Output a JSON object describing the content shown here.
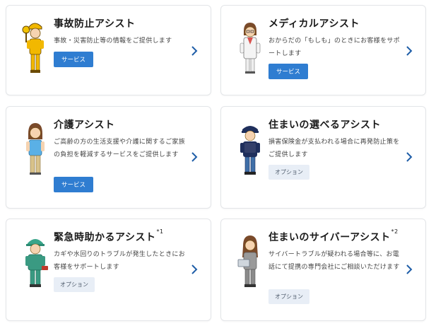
{
  "accent_color": "#2f7dd1",
  "cards": [
    {
      "title": "事故防止アシスト",
      "description": "事故・災害防止等の情報をご提供します",
      "badge": "サービス",
      "badge_type": "service",
      "icon": "child-crossing-guard-icon"
    },
    {
      "title": "メディカルアシスト",
      "description": "おからだの「もしも」のときにお客様をサポートします",
      "badge": "サービス",
      "badge_type": "service",
      "icon": "doctor-icon"
    },
    {
      "title": "介護アシスト",
      "description": "ご高齢の方の生活支援や介護に関するご家族の負担を軽減するサービスをご提供します",
      "badge": "サービス",
      "badge_type": "service",
      "icon": "caregiver-icon"
    },
    {
      "title": "住まいの選べるアシスト",
      "description": "損害保険金が支払われる場合に再発防止策をご提供します",
      "badge": "オプション",
      "badge_type": "option",
      "icon": "security-guard-icon"
    },
    {
      "title": "緊急時助かるアシスト",
      "title_note": "*1",
      "description": "カギや水回りのトラブルが発生したときにお客様をサポートします",
      "badge": "オプション",
      "badge_type": "option",
      "icon": "repair-worker-icon"
    },
    {
      "title": "住まいのサイバーアシスト",
      "title_note": "*2",
      "description": "サイバートラブルが疑われる場合等に、お電話にて提携の専門会社にご相談いただけます",
      "badge": "オプション",
      "badge_type": "option",
      "icon": "laptop-user-icon"
    }
  ]
}
